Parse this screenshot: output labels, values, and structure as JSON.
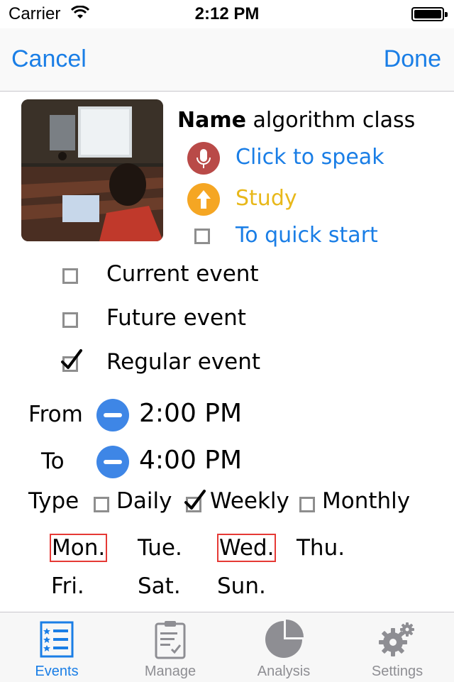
{
  "status_bar": {
    "carrier": "Carrier",
    "time": "2:12 PM"
  },
  "nav": {
    "cancel": "Cancel",
    "done": "Done"
  },
  "event": {
    "name_label": "Name",
    "name_value": "algorithm class",
    "speak_label": "Click to speak",
    "study_label": "Study",
    "quick_start_label": "To quick start"
  },
  "event_kinds": [
    {
      "label": "Current event",
      "checked": false
    },
    {
      "label": "Future event",
      "checked": false
    },
    {
      "label": "Regular event",
      "checked": true
    }
  ],
  "time": {
    "from_label": "From",
    "from_value": "2:00 PM",
    "to_label": "To",
    "to_value": "4:00 PM"
  },
  "type": {
    "label": "Type",
    "options": [
      {
        "label": "Daily",
        "checked": false
      },
      {
        "label": "Weekly",
        "checked": true
      },
      {
        "label": "Monthly",
        "checked": false
      }
    ]
  },
  "days": [
    {
      "label": "Mon.",
      "selected": true
    },
    {
      "label": "Tue.",
      "selected": false
    },
    {
      "label": "Wed.",
      "selected": true
    },
    {
      "label": "Thu.",
      "selected": false
    },
    {
      "label": "Fri.",
      "selected": false
    },
    {
      "label": "Sat.",
      "selected": false
    },
    {
      "label": "Sun.",
      "selected": false
    }
  ],
  "tabs": [
    {
      "label": "Events",
      "icon": "list-icon",
      "active": true
    },
    {
      "label": "Manage",
      "icon": "clipboard-icon",
      "active": false
    },
    {
      "label": "Analysis",
      "icon": "pie-chart-icon",
      "active": false
    },
    {
      "label": "Settings",
      "icon": "gear-icon",
      "active": false
    }
  ],
  "colors": {
    "accent_blue": "#1a7ee6",
    "mic_red": "#b94a48",
    "study_orange": "#f5a623",
    "study_text": "#e8b81a",
    "minus_blue": "#3e86e6",
    "day_selected_border": "#e53935"
  }
}
